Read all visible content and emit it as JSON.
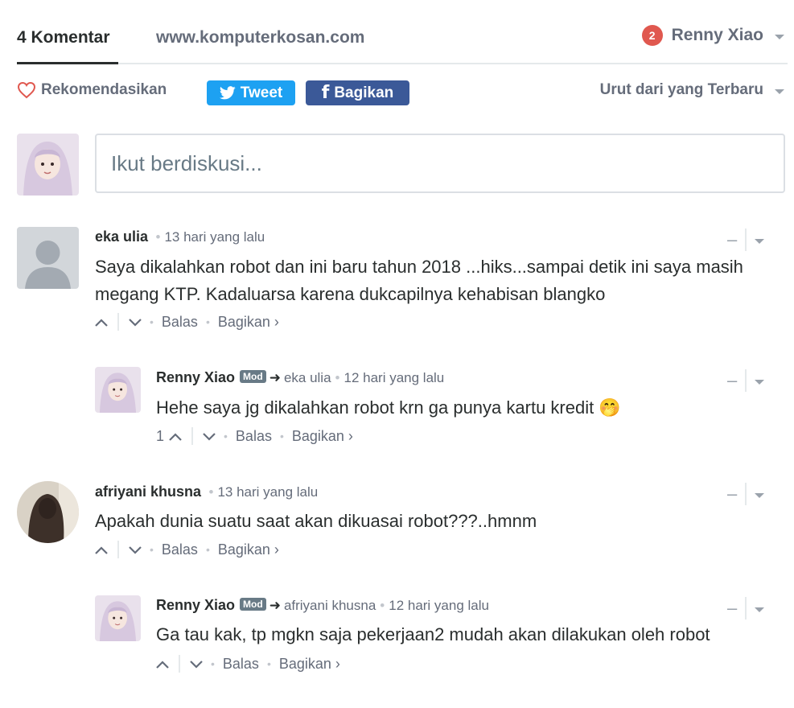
{
  "header": {
    "comment_count_tab": "4 Komentar",
    "site_tab": "www.komputerkosan.com",
    "notification_count": "2",
    "user_name": "Renny Xiao"
  },
  "actions": {
    "recommend_label": "Rekomendasikan",
    "tweet_label": "Tweet",
    "share_label": "Bagikan",
    "sort_label": "Urut dari yang Terbaru"
  },
  "composer": {
    "placeholder": "Ikut berdiskusi..."
  },
  "comments": [
    {
      "author": "eka ulia",
      "time": "13 hari yang lalu",
      "text": "Saya dikalahkan robot dan ini baru tahun 2018 ...hiks...sampai detik ini saya masih megang KTP. Kadaluarsa karena dukcapilnya kehabisan blangko",
      "reply_label": "Balas",
      "share_label": "Bagikan ›",
      "replies": [
        {
          "author": "Renny Xiao",
          "badge": "Mod",
          "reply_to": "eka ulia",
          "time": "12 hari yang lalu",
          "text": "Hehe saya jg dikalahkan robot krn ga punya kartu kredit 🤭",
          "votes": "1",
          "reply_label": "Balas",
          "share_label": "Bagikan ›"
        }
      ]
    },
    {
      "author": "afriyani khusna",
      "time": "13 hari yang lalu",
      "text": "Apakah dunia suatu saat akan dikuasai robot???..hmnm",
      "reply_label": "Balas",
      "share_label": "Bagikan ›",
      "replies": [
        {
          "author": "Renny Xiao",
          "badge": "Mod",
          "reply_to": "afriyani khusna",
          "time": "12 hari yang lalu",
          "text": "Ga tau kak, tp mgkn saja pekerjaan2 mudah akan dilakukan oleh robot",
          "votes": "",
          "reply_label": "Balas",
          "share_label": "Bagikan ›"
        }
      ]
    }
  ],
  "colors": {
    "text": "#2a2e2e",
    "muted": "#656c7a",
    "twitter": "#1da1f2",
    "facebook": "#3b5998",
    "badge": "#e0584f"
  }
}
